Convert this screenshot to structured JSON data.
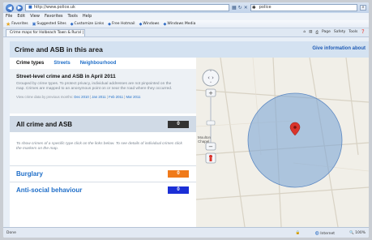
{
  "browser": {
    "address": "http://www.police.uk",
    "search_text": "police",
    "menu": [
      "File",
      "Edit",
      "View",
      "Favorites",
      "Tools",
      "Help"
    ],
    "favorites_label": "Favorites",
    "fav_items": [
      "Suggested Sites",
      "Customize Links",
      "Free Hotmail",
      "Windows",
      "Windows Media"
    ],
    "tab_title": "Crime maps for Holbeach Town & Rural | Police.uk",
    "cmd_items": [
      "Page",
      "Safety",
      "Tools"
    ],
    "status": {
      "done": "Done",
      "zone": "Internet",
      "zoom": "100%"
    }
  },
  "panel": {
    "title": "Crime and ASB in this area",
    "give_info": "Give information about"
  },
  "tabs": {
    "crime_types": "Crime types",
    "streets": "Streets",
    "neighbourhood": "Neighbourhood"
  },
  "description": {
    "title": "Street-level crime and ASB in April 2011",
    "body": "Grouped by crime types. To protect privacy, individual addresses are not pinpointed on the map. Crimes are mapped to an anonymous point on or near the road where they occurred.",
    "prev_label": "View crime data by previous months:",
    "months": [
      "Dec 2010",
      "Jan 2011",
      "Feb 2011",
      "Mar 2011"
    ]
  },
  "all_crime": {
    "label": "All crime and ASB",
    "count": "0",
    "count_color": "#333333"
  },
  "hint": "To show crimes of a specific type click on the links below. To see details of individual crimes click the markers on the map.",
  "categories": [
    {
      "label": "Burglary",
      "count": "0",
      "color": "#f07a1a"
    },
    {
      "label": "Anti-social behaviour",
      "count": "0",
      "color": "#1b2fd6"
    }
  ],
  "map": {
    "place_label": "Moulton Chapel",
    "circle_color": "#7fa6d6",
    "marker_color": "#d9342b"
  }
}
